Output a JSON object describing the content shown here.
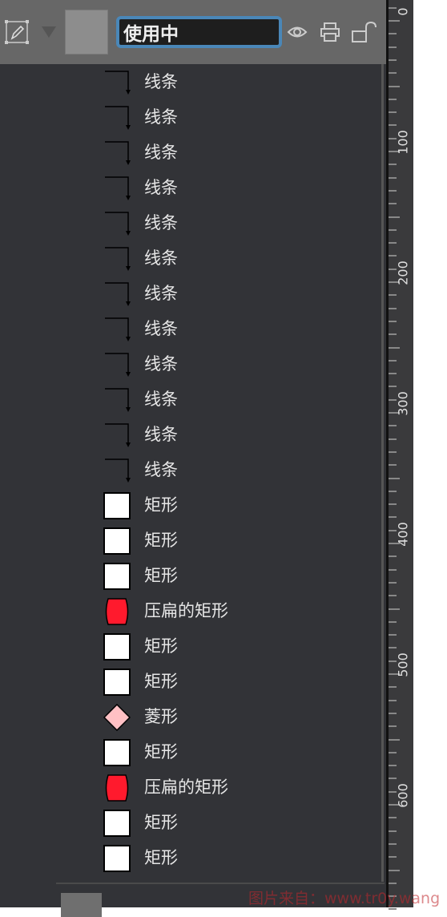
{
  "header": {
    "layer_name": "使用中",
    "icons": [
      "edit-pencil-icon",
      "expand-triangle-icon",
      "eye-icon",
      "printer-icon",
      "unlock-icon"
    ]
  },
  "items": [
    {
      "label": "线条",
      "type": "line"
    },
    {
      "label": "线条",
      "type": "line"
    },
    {
      "label": "线条",
      "type": "line"
    },
    {
      "label": "线条",
      "type": "line"
    },
    {
      "label": "线条",
      "type": "line"
    },
    {
      "label": "线条",
      "type": "line"
    },
    {
      "label": "线条",
      "type": "line"
    },
    {
      "label": "线条",
      "type": "line"
    },
    {
      "label": "线条",
      "type": "line"
    },
    {
      "label": "线条",
      "type": "line"
    },
    {
      "label": "线条",
      "type": "line"
    },
    {
      "label": "线条",
      "type": "line"
    },
    {
      "label": "矩形",
      "type": "rect"
    },
    {
      "label": "矩形",
      "type": "rect"
    },
    {
      "label": "矩形",
      "type": "rect"
    },
    {
      "label": "压扁的矩形",
      "type": "squashed"
    },
    {
      "label": "矩形",
      "type": "rect"
    },
    {
      "label": "矩形",
      "type": "rect"
    },
    {
      "label": "菱形",
      "type": "diamond"
    },
    {
      "label": "矩形",
      "type": "rect"
    },
    {
      "label": "压扁的矩形",
      "type": "squashed"
    },
    {
      "label": "矩形",
      "type": "rect"
    },
    {
      "label": "矩形",
      "type": "rect"
    }
  ],
  "ruler": {
    "labels": [
      "0",
      "100",
      "200",
      "300",
      "400",
      "500",
      "600"
    ]
  },
  "colors": {
    "squashed_fill": "#ff1a2d",
    "diamond_fill": "#ffc0c4",
    "accent": "#4a87b8"
  },
  "watermark": "图片来自：www.tr0y.wang"
}
